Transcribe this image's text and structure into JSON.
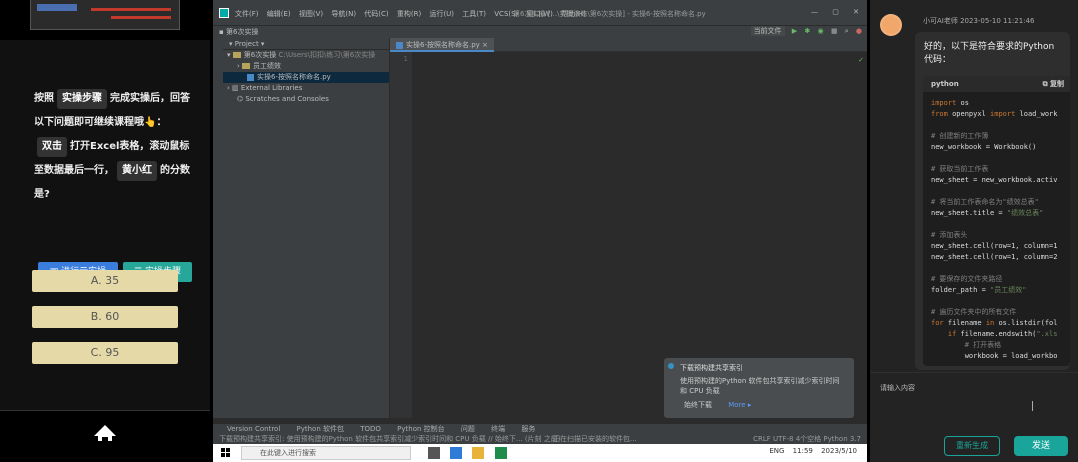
{
  "quiz": {
    "q_part1": "按照",
    "tag_steps": "实操步骤",
    "q_part2": "完成实操后，回答以下问题即可继续课程哦",
    "q_part2_hand": "👆：",
    "tag_dblclick": "双击",
    "q_part3": "打开Excel表格，滚动鼠标至数据最后一行，",
    "tag_name": "黄小红",
    "q_part4": "的分数是?",
    "btn_practice": "进行云实操",
    "btn_steps": "实操步骤",
    "options": [
      "A. 35",
      "B. 60",
      "C. 95"
    ]
  },
  "ide": {
    "menu": [
      "文件(F)",
      "编辑(E)",
      "视图(V)",
      "导航(N)",
      "代码(C)",
      "重构(R)",
      "运行(U)",
      "工具(T)",
      "VCS(S)",
      "窗口(W)",
      "帮助(H)"
    ],
    "title": "第6次实操 [...\\实操演练\\第6次实操] - 实操6-按照名称命名.py",
    "nav": "第6次实操",
    "run_config": "当前文件",
    "project_header": "Project",
    "tree": [
      {
        "label": "第6次实操",
        "path": "C:\\Users\\扣扣\\练习\\第6次实操",
        "kind": "folder"
      },
      {
        "label": "员工绩效",
        "kind": "folder"
      },
      {
        "label": "实操6-按照名称命名.py",
        "kind": "py"
      },
      {
        "label": "External Libraries",
        "kind": "lib"
      },
      {
        "label": "Scratches and Consoles",
        "kind": "scratch"
      }
    ],
    "tab": "实操6-按照名称命名.py",
    "line_no": "1",
    "notification": {
      "title": "下载预构建共享索引",
      "body": "使用预构建的Python 软件包共享索引减少索引时间和 CPU 负载",
      "action1": "始终下载",
      "action2": "More ▸"
    },
    "bottom_tabs": [
      "Version Control",
      "Python 软件包",
      "TODO",
      "Python 控制台",
      "问题",
      "终端",
      "服务"
    ],
    "status_left": "下载预构建共享索引: 使用预构建的Python 软件包共享索引减少索引时间和 CPU 负载 // 始终下... (片刻 之前)",
    "status_mid": "正在扫描已安装的软件包...",
    "status_right": "CRLF  UTF-8  4个空格  Python 3.7"
  },
  "taskbar": {
    "search_placeholder": "在此键入进行搜索",
    "lang": "ENG",
    "time": "11:59",
    "date": "2023/5/10"
  },
  "ai": {
    "sender": "小可AI老师",
    "timestamp": "2023-05-10 11:21:46",
    "intro": "好的，以下是符合要求的Python代码：",
    "code_lang": "python",
    "copy_label": "复制",
    "code_lines": [
      "import os",
      "from openpyxl import load_work",
      "",
      "# 创建新的工作簿",
      "new_workbook = Workbook()",
      "",
      "# 获取当前工作表",
      "new_sheet = new_workbook.activ",
      "",
      "# 将当前工作表命名为\"绩效总表\"",
      "new_sheet.title = \"绩效总表\"",
      "",
      "# 添加表头",
      "new_sheet.cell(row=1, column=1",
      "new_sheet.cell(row=1, column=2",
      "",
      "# 要保存的文件夹路径",
      "folder_path = \"员工绩效\"",
      "",
      "# 遍历文件夹中的所有文件",
      "for filename in os.listdir(fol",
      "    if filename.endswith(\".xls",
      "        # 打开表格",
      "        workbook = load_workbo"
    ],
    "input_placeholder": "请输入内容",
    "btn_stop": "重新生成",
    "btn_send": "发送"
  }
}
